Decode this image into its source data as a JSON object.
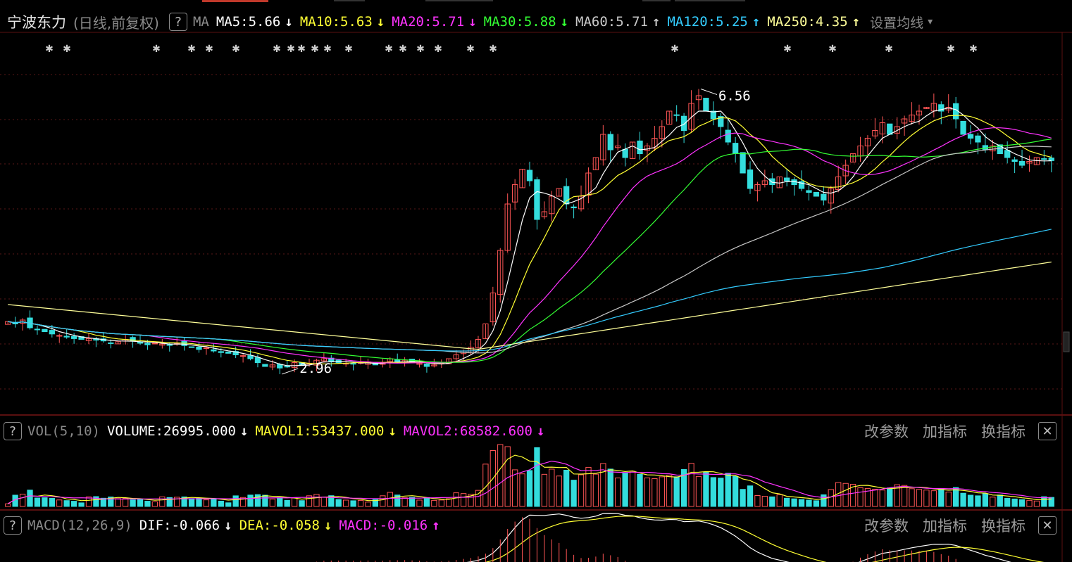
{
  "header": {
    "stock_name": "宁波东力",
    "period": "(日线,前复权)",
    "help_label": "?",
    "indicator": "MA",
    "ma_items": [
      {
        "label": "MA5:5.66",
        "arrow": "↓",
        "color": "#ffffff"
      },
      {
        "label": "MA10:5.63",
        "arrow": "↓",
        "color": "#ffff33"
      },
      {
        "label": "MA20:5.71",
        "arrow": "↓",
        "color": "#ff33ff"
      },
      {
        "label": "MA30:5.88",
        "arrow": "↓",
        "color": "#33ff33"
      },
      {
        "label": "MA60:5.71",
        "arrow": "↑",
        "color": "#c8c8c8"
      },
      {
        "label": "MA120:5.25",
        "arrow": "↑",
        "color": "#33ccff"
      },
      {
        "label": "MA250:4.35",
        "arrow": "↑",
        "color": "#ffff99"
      }
    ],
    "setting_label": "设置均线",
    "caret": "▾"
  },
  "price_chart": {
    "high_label": "6.56",
    "low_label": "2.96"
  },
  "volume_panel": {
    "help_label": "?",
    "name": "VOL(5,10)",
    "items": [
      {
        "label": "VOLUME:26995.000",
        "arrow": "↓",
        "color": "#ffffff"
      },
      {
        "label": "MAVOL1:53437.000",
        "arrow": "↓",
        "color": "#ffff33"
      },
      {
        "label": "MAVOL2:68582.600",
        "arrow": "↓",
        "color": "#ff33ff"
      }
    ],
    "buttons": [
      "改参数",
      "加指标",
      "换指标"
    ],
    "close_label": "✕"
  },
  "macd_panel": {
    "help_label": "?",
    "name": "MACD(12,26,9)",
    "items": [
      {
        "label": "DIF:-0.066",
        "arrow": "↓",
        "color": "#ffffff"
      },
      {
        "label": "DEA:-0.058",
        "arrow": "↓",
        "color": "#ffff33"
      },
      {
        "label": "MACD:-0.016",
        "arrow": "↑",
        "color": "#ff33ff"
      }
    ],
    "buttons": [
      "改参数",
      "加指标",
      "换指标"
    ],
    "close_label": "✕"
  },
  "chart_data": {
    "type": "candlestick",
    "title": "宁波东力 (日线,前复权)",
    "ylim": [
      2.6,
      6.9
    ],
    "closes": [
      3.58,
      3.55,
      3.6,
      3.5,
      3.48,
      3.45,
      3.42,
      3.4,
      3.38,
      3.36,
      3.35,
      3.36,
      3.34,
      3.33,
      3.3,
      3.32,
      3.35,
      3.33,
      3.3,
      3.28,
      3.3,
      3.29,
      3.28,
      3.3,
      3.27,
      3.25,
      3.22,
      3.24,
      3.2,
      3.18,
      3.17,
      3.15,
      3.14,
      3.1,
      3.05,
      3.0,
      3.02,
      2.98,
      3.0,
      3.05,
      3.02,
      3.04,
      3.08,
      3.1,
      3.06,
      3.05,
      3.04,
      3.03,
      3.05,
      3.06,
      3.02,
      3.04,
      3.1,
      3.06,
      3.08,
      3.05,
      3.04,
      3.0,
      3.02,
      3.05,
      3.1,
      3.15,
      3.2,
      3.25,
      3.35,
      3.55,
      3.95,
      4.5,
      5.1,
      5.35,
      5.55,
      5.4,
      4.9,
      5.0,
      5.2,
      5.3,
      5.1,
      5.05,
      5.2,
      5.5,
      5.7,
      6.0,
      5.8,
      5.85,
      5.7,
      5.9,
      5.75,
      5.85,
      5.95,
      6.1,
      6.3,
      6.25,
      6.05,
      6.4,
      6.5,
      6.3,
      6.2,
      6.1,
      5.9,
      5.75,
      5.5,
      5.3,
      5.35,
      5.4,
      5.35,
      5.45,
      5.4,
      5.35,
      5.3,
      5.25,
      5.2,
      5.15,
      5.3,
      5.45,
      5.6,
      5.75,
      5.85,
      5.95,
      6.05,
      6.15,
      6.0,
      6.1,
      6.2,
      6.25,
      6.3,
      6.35,
      6.4,
      6.3,
      6.35,
      6.2,
      6.0,
      5.95,
      5.9,
      5.8,
      5.85,
      5.75,
      5.7,
      5.65,
      5.6,
      5.65,
      5.7,
      5.68,
      5.66
    ],
    "ma250": {
      "start": 3.8,
      "min": 3.22,
      "end": 4.35
    }
  }
}
